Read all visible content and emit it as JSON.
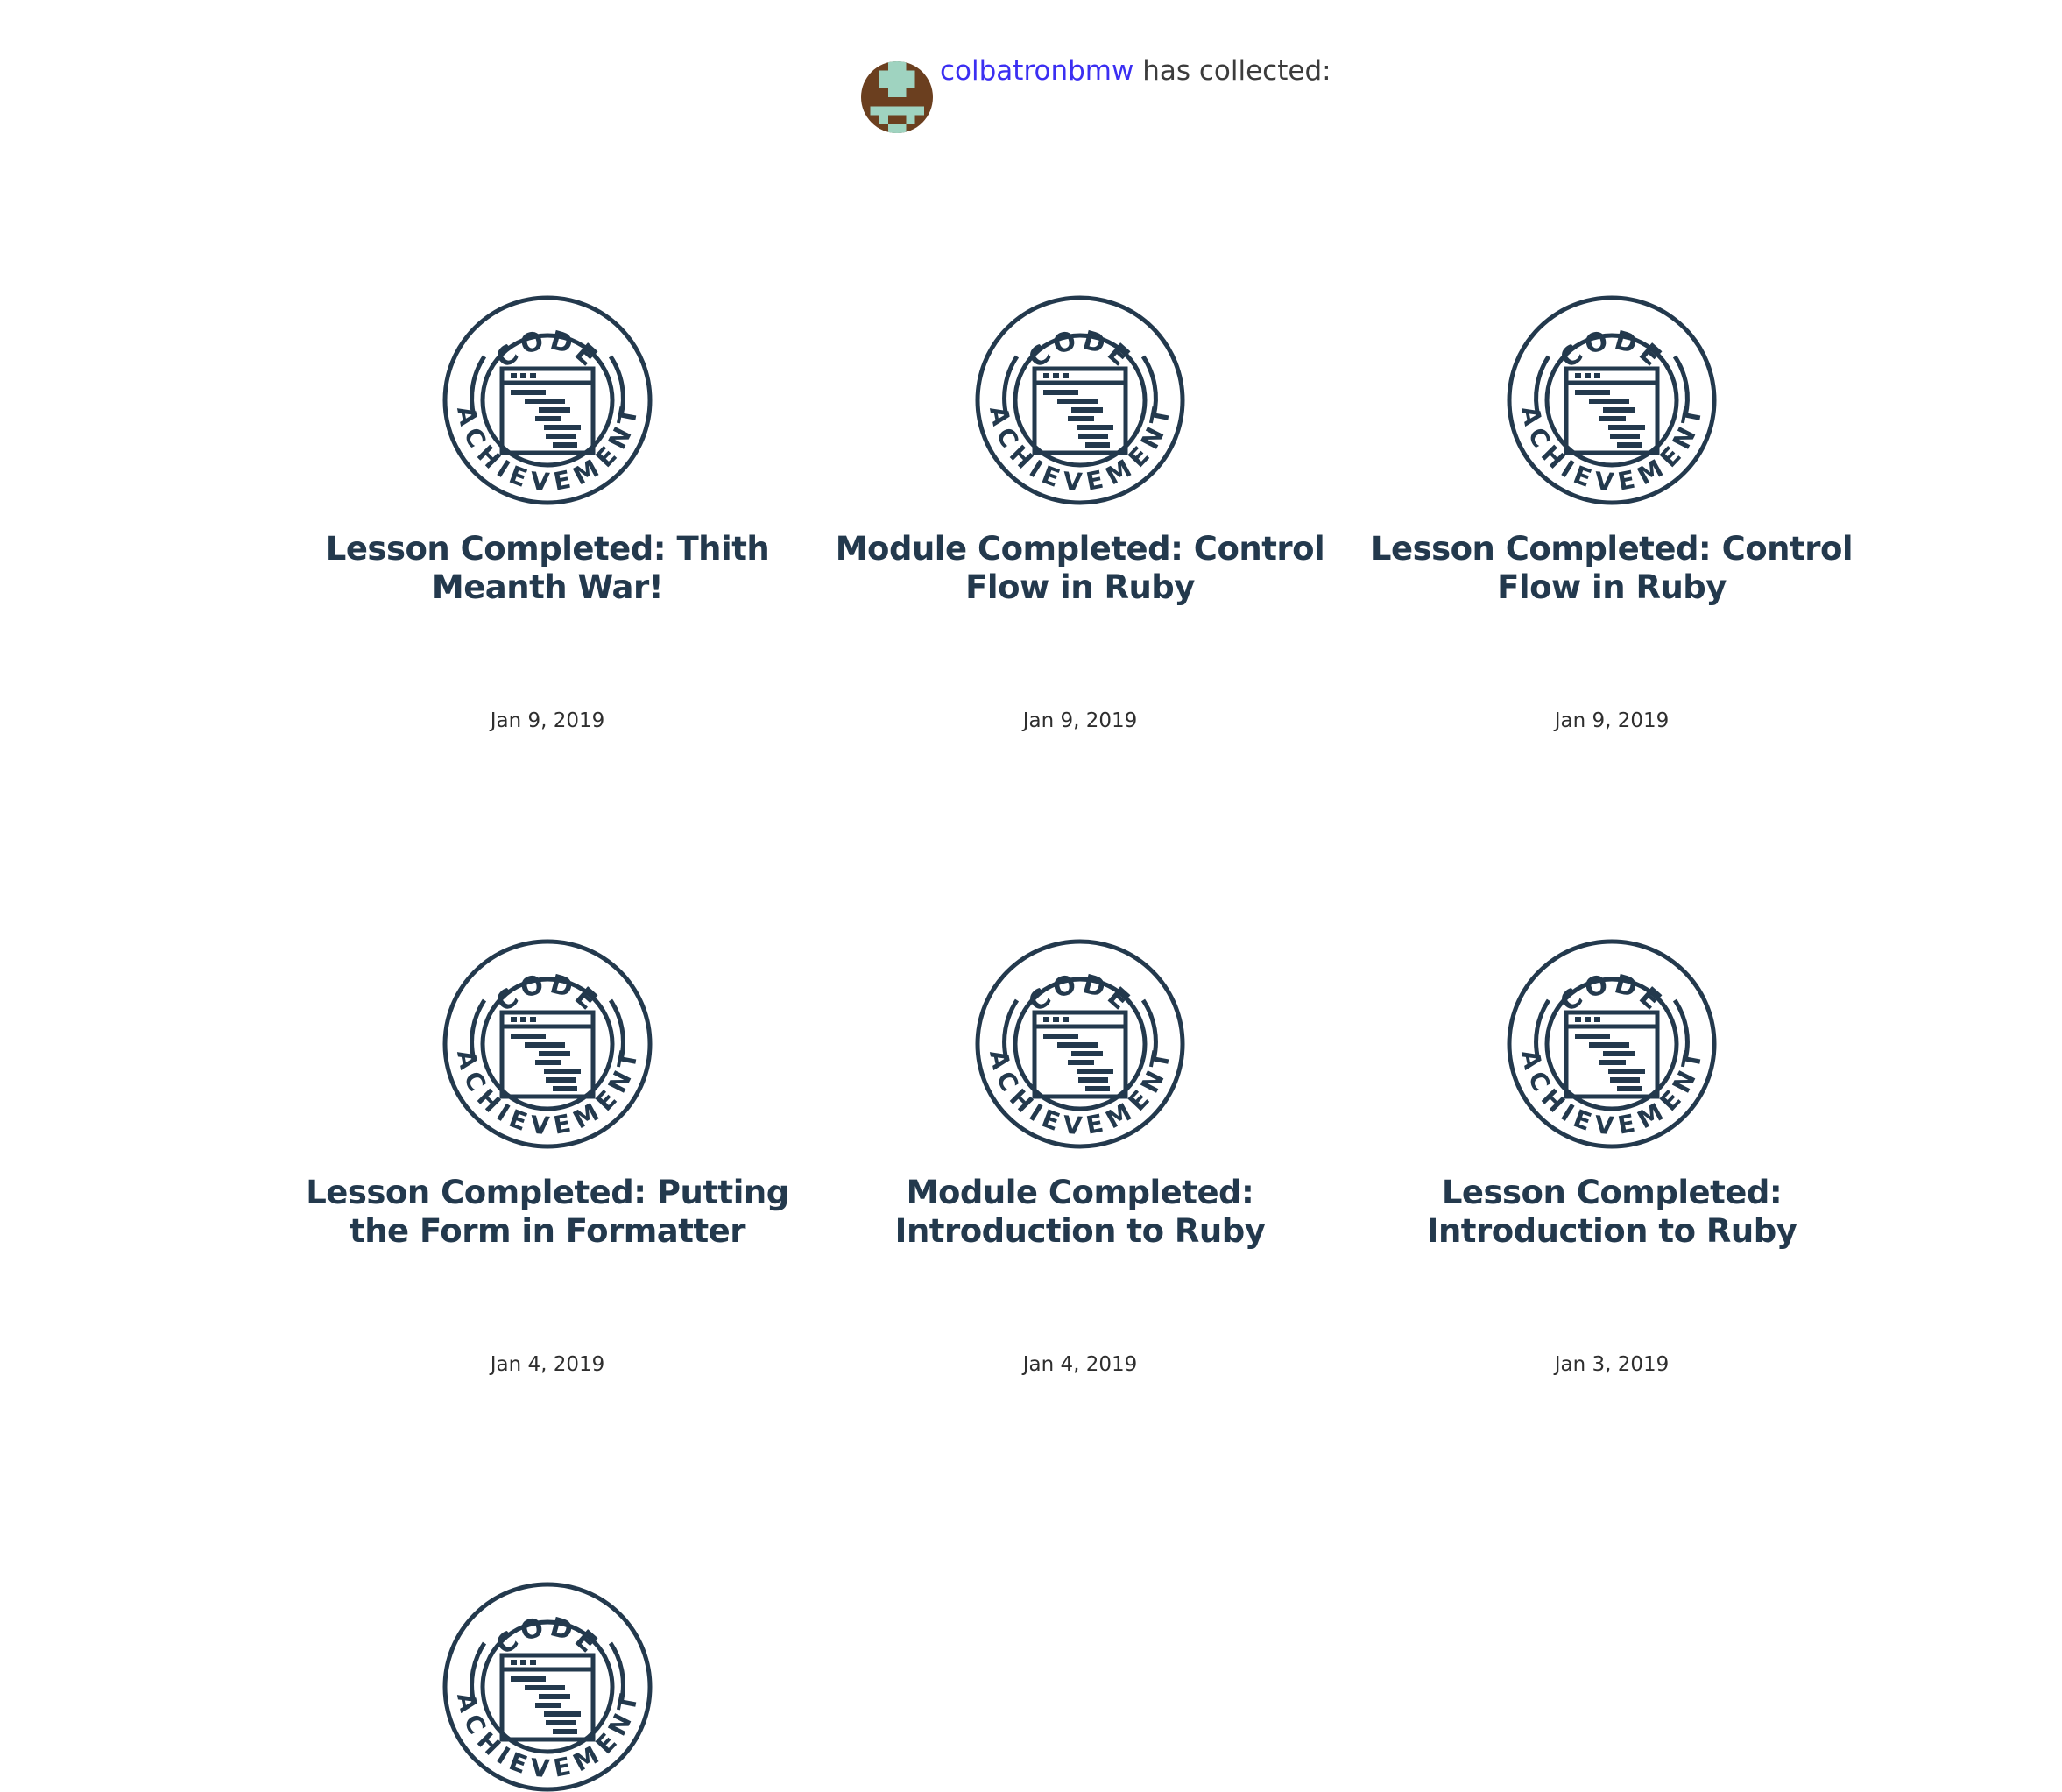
{
  "header": {
    "username": "colbatronbmw",
    "suffix": " has collected:"
  },
  "badge": {
    "top_text": "CODE",
    "bottom_text": "ACHIEVEMENT",
    "color": "#23394d"
  },
  "achievements": [
    {
      "title_line1": "Lesson Completed: Thith",
      "title_line2": "Meanth War!",
      "date": "Jan 9, 2019"
    },
    {
      "title_line1": "Module Completed: Control",
      "title_line2": "Flow in Ruby",
      "date": "Jan 9, 2019"
    },
    {
      "title_line1": "Lesson Completed: Control",
      "title_line2": "Flow in Ruby",
      "date": "Jan 9, 2019"
    },
    {
      "title_line1": "Lesson Completed: Putting",
      "title_line2": "the Form in Formatter",
      "date": "Jan 4, 2019"
    },
    {
      "title_line1": "Module Completed:",
      "title_line2": "Introduction to Ruby",
      "date": "Jan 4, 2019"
    },
    {
      "title_line1": "Lesson Completed:",
      "title_line2": "Introduction to Ruby",
      "date": "Jan 3, 2019"
    },
    {
      "title_line1": "",
      "title_line2": "",
      "date": ""
    }
  ]
}
